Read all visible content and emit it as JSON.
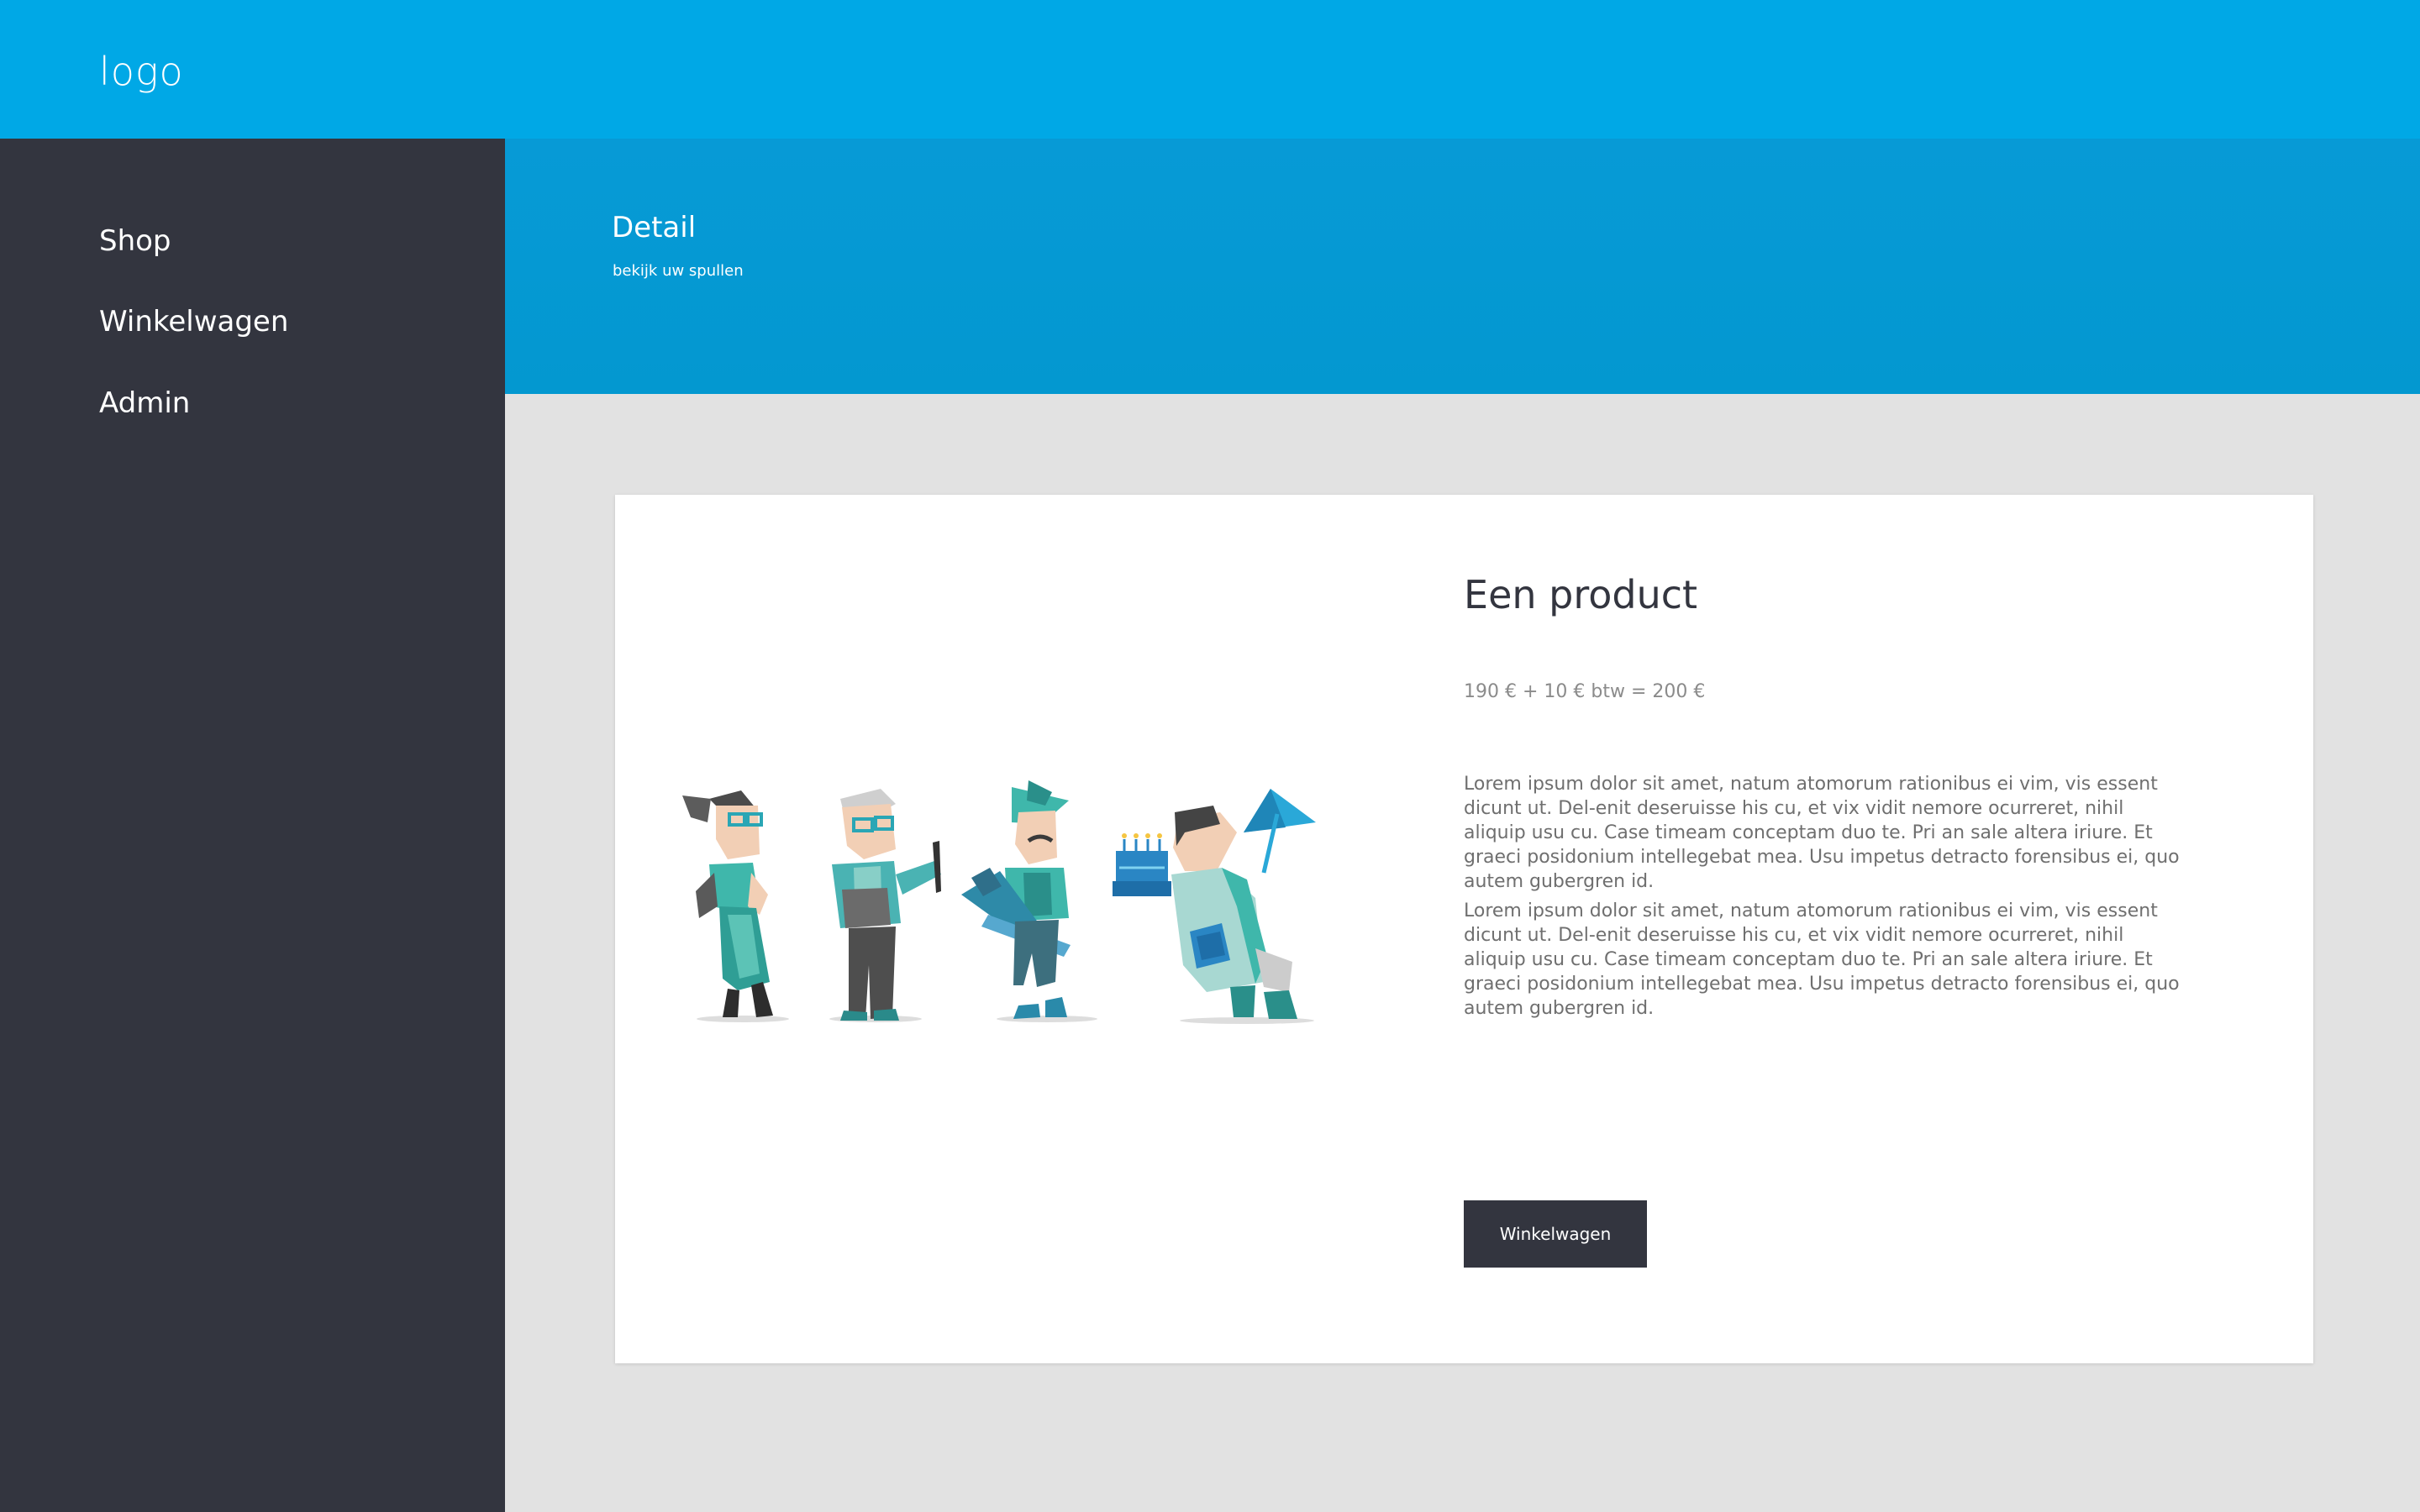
{
  "header": {
    "logo": "logo"
  },
  "sidebar": {
    "items": [
      {
        "label": "Shop"
      },
      {
        "label": "Winkelwagen"
      },
      {
        "label": "Admin"
      }
    ]
  },
  "hero": {
    "title": "Detail",
    "subtitle": "bekijk uw spullen"
  },
  "product": {
    "title": "Een product",
    "price": "190 € + 10 € btw =  200 €",
    "paragraphs": [
      "Lorem ipsum dolor sit amet, natum atomorum rationibus ei vim, vis essent dicunt ut. Del-enit deseruisse his cu, et vix vidit nemore ocurreret, nihil aliquip usu cu. Case timeam conceptam duo te. Pri an sale altera iriure. Et graeci posidonium intellegebat mea. Usu impetus detracto forensibus ei, quo autem gubergren id.",
      "Lorem ipsum dolor sit amet, natum atomorum rationibus ei vim, vis essent dicunt ut. Del-enit deseruisse his cu, et vix vidit nemore ocurreret, nihil aliquip usu cu. Case timeam conceptam duo te. Pri an sale altera iriure. Et graeci posidonium intellegebat mea. Usu impetus detracto forensibus ei, quo autem gubergren id."
    ],
    "button_label": "Winkelwagen"
  },
  "colors": {
    "topbar": "#00a8e6",
    "hero": "#0398d0",
    "sidebar": "#33353f",
    "background": "#e2e2e2",
    "teal": "#3bb3b0",
    "dark_teal": "#1f7f86"
  }
}
